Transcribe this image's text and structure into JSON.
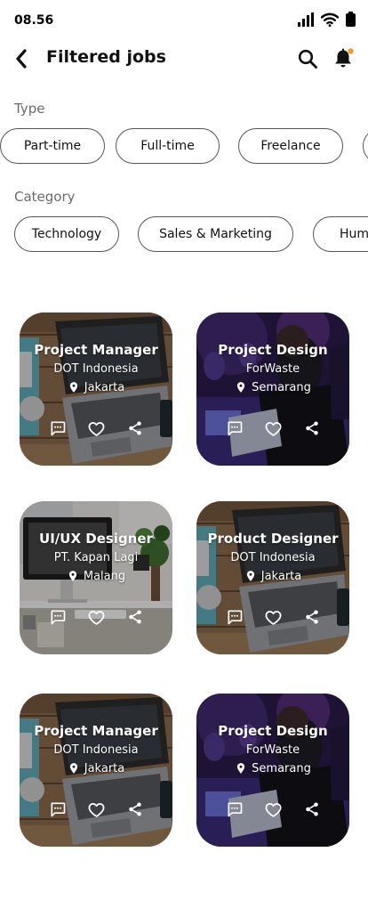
{
  "status_bar": {
    "time": "08.56"
  },
  "header": {
    "title": "Filtered jobs"
  },
  "filters": {
    "type_label": "Type",
    "type_chips": [
      "Part-time",
      "Full-time",
      "Freelance",
      ""
    ],
    "category_label": "Category",
    "category_chips": [
      "Technology",
      "Sales & Marketing",
      "Human"
    ]
  },
  "theme": {
    "notification_dot": "#f39b2a",
    "chip_border": "#555555",
    "section_label": "#6b6b6b"
  },
  "jobs": [
    {
      "title": "Project Manager",
      "company": "DOT Indonesia",
      "location": "Jakarta",
      "image": "laptop-on-wooden-desk"
    },
    {
      "title": "Project Design",
      "company": "ForWaste",
      "location": "Semarang",
      "image": "people-at-hackathon"
    },
    {
      "title": "UI/UX Designer",
      "company": "PT. Kapan Lagi",
      "location": "Malang",
      "image": "office-desk-with-imac"
    },
    {
      "title": "Product Designer",
      "company": "DOT Indonesia",
      "location": "Jakarta",
      "image": "laptop-on-wooden-desk"
    },
    {
      "title": "Project Manager",
      "company": "DOT Indonesia",
      "location": "Jakarta",
      "image": "laptop-on-wooden-desk"
    },
    {
      "title": "Project Design",
      "company": "ForWaste",
      "location": "Semarang",
      "image": "people-at-hackathon"
    }
  ]
}
